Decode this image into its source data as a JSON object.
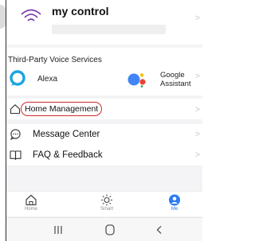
{
  "account": {
    "title": "my control"
  },
  "voice_services": {
    "title": "Third-Party Voice Services",
    "items": [
      {
        "label": "Alexa",
        "icon": "alexa-icon"
      },
      {
        "label_line1": "Google",
        "label_line2": "Assistant",
        "icon": "google-assistant-icon"
      }
    ]
  },
  "home_management": {
    "label": "Home Management",
    "icon": "home-outline-icon",
    "highlight_color": "#d02a2a"
  },
  "menu": [
    {
      "label": "Message Center",
      "icon": "chat-bubble-icon"
    },
    {
      "label": "FAQ & Feedback",
      "icon": "book-icon"
    }
  ],
  "tabs": [
    {
      "label": "Home",
      "icon": "home-tab-icon"
    },
    {
      "label": "Smart",
      "icon": "sun-icon"
    },
    {
      "label": "Me",
      "icon": "person-icon",
      "active": true
    }
  ],
  "colors": {
    "accent": "#2a7bf0",
    "page_bg": "#f4f4f6",
    "card_bg": "#ffffff"
  }
}
